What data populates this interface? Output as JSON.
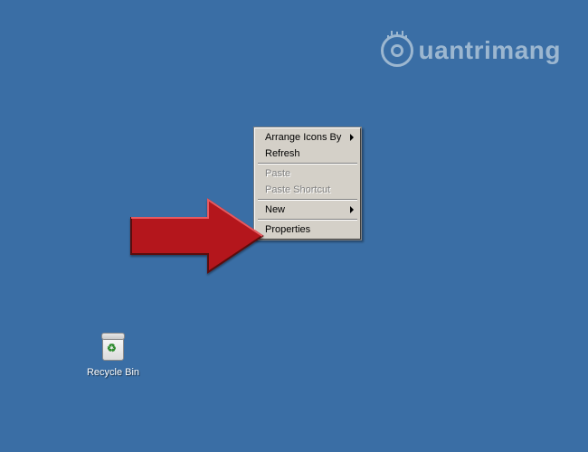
{
  "watermark": {
    "text": "uantrimang"
  },
  "desktop": {
    "icons": [
      {
        "name": "recycle-bin",
        "label": "Recycle Bin"
      }
    ]
  },
  "context_menu": {
    "items": [
      {
        "label": "Arrange Icons By",
        "enabled": true,
        "submenu": true
      },
      {
        "label": "Refresh",
        "enabled": true,
        "submenu": false
      },
      {
        "sep": true
      },
      {
        "label": "Paste",
        "enabled": false,
        "submenu": false
      },
      {
        "label": "Paste Shortcut",
        "enabled": false,
        "submenu": false
      },
      {
        "sep": true
      },
      {
        "label": "New",
        "enabled": true,
        "submenu": true
      },
      {
        "sep": true
      },
      {
        "label": "Properties",
        "enabled": true,
        "submenu": false
      }
    ]
  },
  "arrow": {
    "target": "Properties",
    "color": "#b4151c"
  }
}
